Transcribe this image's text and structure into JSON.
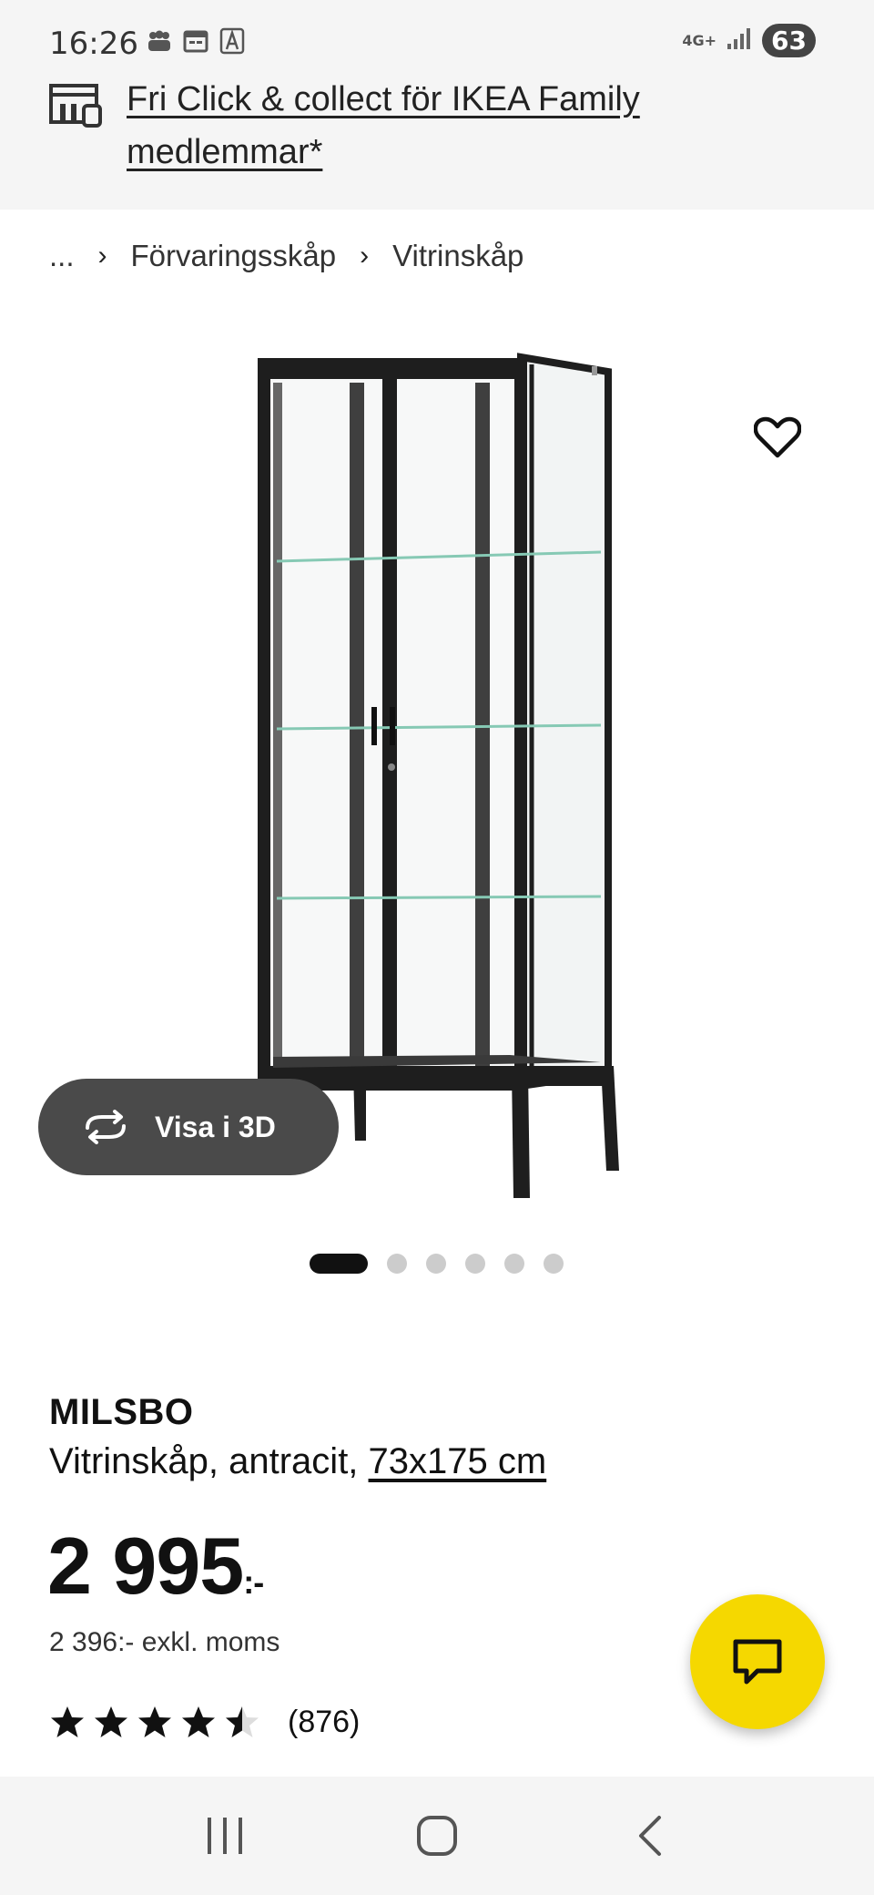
{
  "status_bar": {
    "time": "16:26",
    "network": "4G+",
    "battery": "63"
  },
  "promo": {
    "text": "Fri Click & collect för IKEA Family medlemmar*"
  },
  "breadcrumb": {
    "items": [
      "...",
      "Förvaringsskåp",
      "Vitrinskåp"
    ]
  },
  "gallery": {
    "view3d_label": "Visa i 3D",
    "image_count": 6,
    "active_index": 0
  },
  "product": {
    "name": "MILSBO",
    "description": "Vitrinskåp, antracit, ",
    "dimensions": "73x175 cm",
    "price": "2 995",
    "price_suffix": ":-",
    "price_ex_vat": "2 396:- exkl. moms",
    "rating_value": 4.5,
    "rating_count": "(876)"
  },
  "colors": {
    "accent_yellow": "#f5d800",
    "dark_button": "#4a4a4a",
    "text": "#111111"
  }
}
